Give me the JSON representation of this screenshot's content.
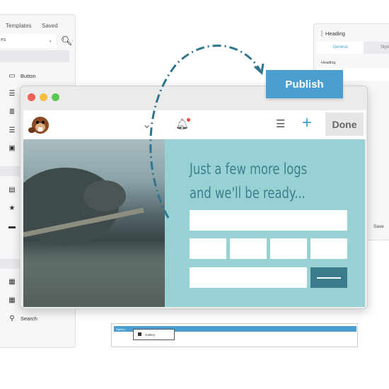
{
  "left_panel": {
    "tabs": [
      "Templates",
      "Saved"
    ],
    "select_value": "es",
    "items": [
      {
        "label": "Button",
        "icon": "button-icon"
      },
      {
        "label": "",
        "icon": "text-icon"
      },
      {
        "label": "",
        "icon": "list-icon"
      },
      {
        "label": "",
        "icon": "text-editor-icon"
      },
      {
        "label": "",
        "icon": "video-icon"
      },
      {
        "label": "",
        "icon": "save-icon"
      },
      {
        "label": "",
        "icon": "star-icon"
      },
      {
        "label": "",
        "icon": "separator-icon"
      },
      {
        "label": "",
        "icon": "table-icon"
      },
      {
        "label": "",
        "icon": "table-icon"
      },
      {
        "label": "Search",
        "icon": "search-icon"
      }
    ]
  },
  "right_panel": {
    "title": "Heading",
    "tabs": [
      "General",
      "Style"
    ],
    "field_label": "Heading",
    "save_label": "Save"
  },
  "window": {
    "done_label": "Done",
    "heading_line1": "Just a few more logs",
    "heading_line2": "and we'll be ready...",
    "colors": {
      "teal": "#97d1d3",
      "heading": "#3c7f8f",
      "submit": "#3a7b8c"
    }
  },
  "publish_label": "Publish",
  "gallery": {
    "bar_label": "Gallery",
    "item_label": "Gallery"
  }
}
